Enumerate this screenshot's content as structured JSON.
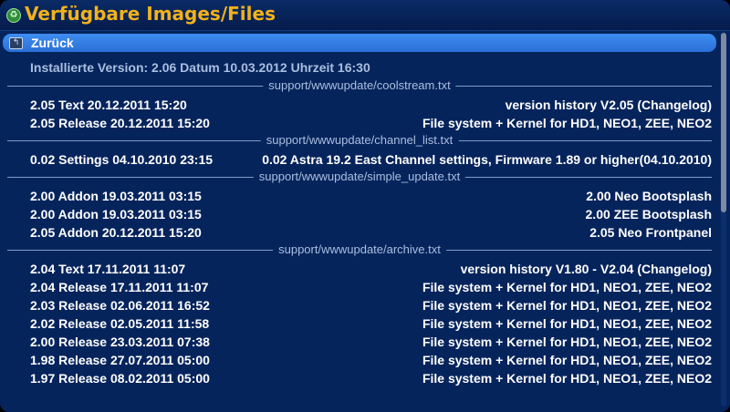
{
  "title": "Verfügbare Images/Files",
  "back": {
    "label": "Zurück"
  },
  "installed": "Installierte Version: 2.06 Datum 10.03.2012 Uhrzeit 16:30",
  "sections": [
    {
      "header": "support/wwwupdate/coolstream.txt",
      "items": [
        {
          "left": "2.05 Text 20.12.2011 15:20",
          "right": "version history V2.05 (Changelog)"
        },
        {
          "left": "2.05 Release 20.12.2011 15:20",
          "right": "File system + Kernel for HD1, NEO1, ZEE, NEO2"
        }
      ]
    },
    {
      "header": "support/wwwupdate/channel_list.txt",
      "items": [
        {
          "left": "0.02 Settings 04.10.2010 23:15",
          "right": "0.02 Astra 19.2 East Channel settings, Firmware 1.89 or higher(04.10.2010)"
        }
      ]
    },
    {
      "header": "support/wwwupdate/simple_update.txt",
      "items": [
        {
          "left": "2.00 Addon 19.03.2011 03:15",
          "right": "2.00 Neo Bootsplash"
        },
        {
          "left": "2.00 Addon 19.03.2011 03:15",
          "right": "2.00 ZEE Bootsplash"
        },
        {
          "left": "2.05 Addon 20.12.2011 15:20",
          "right": "2.05 Neo Frontpanel"
        }
      ]
    },
    {
      "header": "support/wwwupdate/archive.txt",
      "items": [
        {
          "left": "2.04 Text 17.11.2011 11:07",
          "right": "version history V1.80 - V2.04 (Changelog)"
        },
        {
          "left": "2.04 Release 17.11.2011 11:07",
          "right": "File system + Kernel for HD1, NEO1, ZEE, NEO2"
        },
        {
          "left": "2.03 Release 02.06.2011 16:52",
          "right": "File system + Kernel for HD1, NEO1, ZEE, NEO2"
        },
        {
          "left": "2.02 Release 02.05.2011 11:58",
          "right": "File system + Kernel for HD1, NEO1, ZEE, NEO2"
        },
        {
          "left": "2.00 Release 23.03.2011 07:38",
          "right": "File system + Kernel for HD1, NEO1, ZEE, NEO2"
        },
        {
          "left": "1.98 Release 27.07.2011 05:00",
          "right": "File system + Kernel for HD1, NEO1, ZEE, NEO2"
        },
        {
          "left": "1.97 Release 08.02.2011 05:00",
          "right": "File system + Kernel for HD1, NEO1, ZEE, NEO2"
        }
      ]
    }
  ],
  "scroll": {
    "visible_fraction": 0.48
  }
}
